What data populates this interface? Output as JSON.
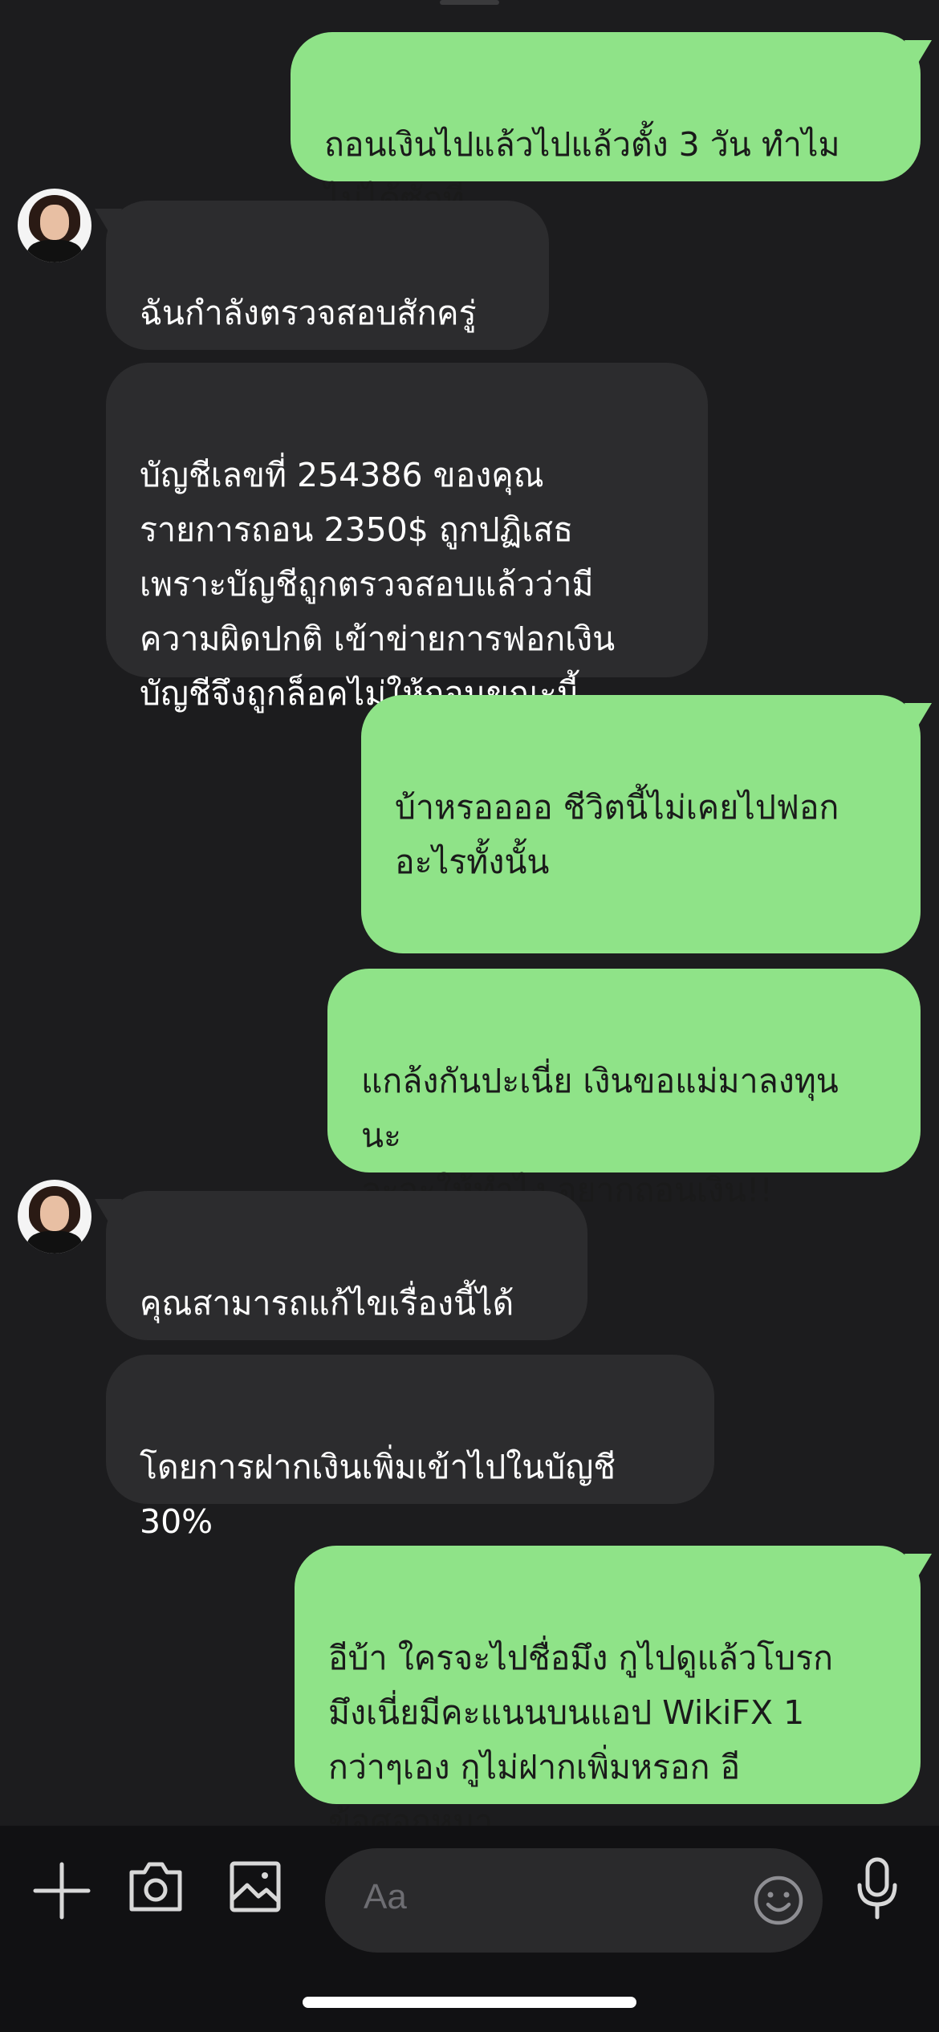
{
  "messages": [
    {
      "sender": "me",
      "text": "ถอนเงินไปแล้วไปแล้วตั้ง 3 วัน ทำไม\nไม่ได้ซักที"
    },
    {
      "sender": "them",
      "text": "ฉันกำลังตรวจสอบสักครู่"
    },
    {
      "sender": "them",
      "text": "บัญชีเลขที่ 254386 ของคุณ\nรายการถอน 2350$ ถูกปฏิเสธ\nเพราะบัญชีถูกตรวจสอบแล้วว่ามี\nความผิดปกติ เข้าข่ายการฟอกเงิน\nบัญชีจึงถูกล็อคไม่ให้ถอนขณะนี้"
    },
    {
      "sender": "me",
      "text": "บ้าหรออออ ชีวิตนี้ไม่เคยไปฟอก\nอะไรทั้งนั้น"
    },
    {
      "sender": "me",
      "text": "แกล้งกันปะเนี่ย เงินขอแม่มาลงทุน\nนะ\nละจะให้ทำไง อยากถอนเงิน!!"
    },
    {
      "sender": "them",
      "text": "คุณสามารถแก้ไขเรื่องนี้ได้"
    },
    {
      "sender": "them",
      "text": "โดยการฝากเงินเพิ่มเข้าไปในบัญชี\n30%"
    },
    {
      "sender": "me",
      "text": "อีบ้า ใครจะไปชื่อมึง กูไปดูแล้วโบรก\nมึงเนี่ยมีคะแนนบนแอป WikiFX 1\nกว่าๆเอง กูไม่ฝากเพิ่มหรอก อี\nข้อศอกหมา"
    }
  ],
  "composer": {
    "placeholder": "Aa",
    "icons": [
      "plus-icon",
      "camera-icon",
      "image-icon",
      "emoji-icon",
      "microphone-icon"
    ]
  },
  "colors": {
    "background": "#1c1c1e",
    "outgoing_bubble": "#8fe388",
    "incoming_bubble": "#2c2c2e",
    "toolbar": "#111113"
  }
}
